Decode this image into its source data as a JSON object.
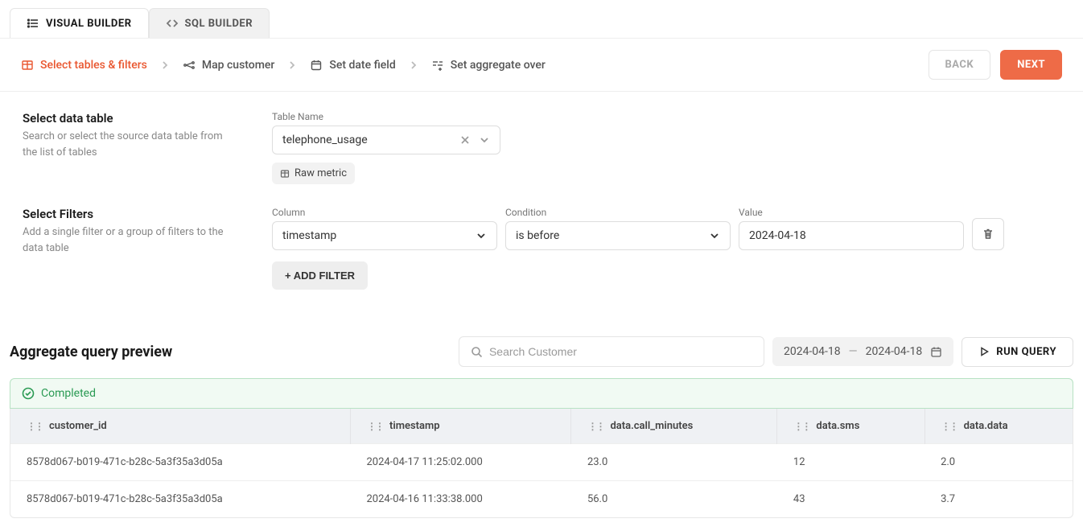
{
  "tabs": {
    "visual": "VISUAL BUILDER",
    "sql": "SQL BUILDER"
  },
  "steps": {
    "s1": "Select tables & filters",
    "s2": "Map customer",
    "s3": "Set date field",
    "s4": "Set aggregate over"
  },
  "buttons": {
    "back": "BACK",
    "next": "NEXT",
    "add_filter": "+ ADD FILTER",
    "run_query": "RUN QUERY"
  },
  "table_section": {
    "title": "Select data table",
    "desc": "Search or select the source data table from the list of tables",
    "field_label": "Table Name",
    "value": "telephone_usage",
    "chip": "Raw metric"
  },
  "filter_section": {
    "title": "Select Filters",
    "desc": "Add a single filter or a group of filters to the data table",
    "col_label": "Column",
    "col_value": "timestamp",
    "cond_label": "Condition",
    "cond_value": "is before",
    "val_label": "Value",
    "val_value": "2024-04-18"
  },
  "preview": {
    "title": "Aggregate query preview",
    "search_placeholder": "Search Customer",
    "date_from": "2024-04-18",
    "date_sep": "—",
    "date_to": "2024-04-18",
    "status": "Completed"
  },
  "table": {
    "headers": [
      "customer_id",
      "timestamp",
      "data.call_minutes",
      "data.sms",
      "data.data"
    ],
    "rows": [
      [
        "8578d067-b019-471c-b28c-5a3f35a3d05a",
        "2024-04-17 11:25:02.000",
        "23.0",
        "12",
        "2.0"
      ],
      [
        "8578d067-b019-471c-b28c-5a3f35a3d05a",
        "2024-04-16 11:33:38.000",
        "56.0",
        "43",
        "3.7"
      ]
    ]
  }
}
